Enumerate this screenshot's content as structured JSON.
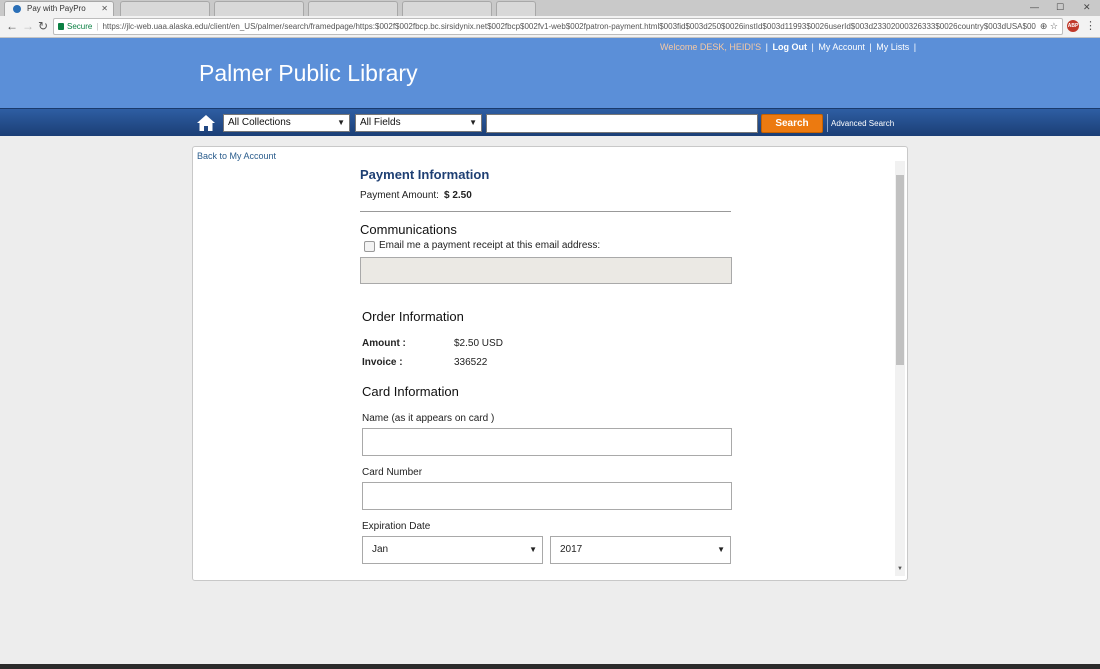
{
  "browser": {
    "active_tab_title": "Pay with PayPro",
    "url_secure_label": "Secure",
    "url": "https://jlc-web.uaa.alaska.edu/client/en_US/palmer/search/framedpage/https:$002f$002fbcp.bc.sirsidynix.net$002fbcp$002fv1-web$002fpatron-payment.html$003fid$003d250$0026instId$003d11993$0026userId$003d23302000326333$0026country$003dUSA$00",
    "ext_label": "ABP"
  },
  "header": {
    "brand": "Palmer Public Library",
    "welcome": "Welcome DESK, HEIDI'S",
    "logout": "Log Out",
    "my_account": "My Account",
    "my_lists": "My Lists",
    "pipe": "|"
  },
  "search": {
    "collection": "All Collections",
    "field": "All Fields",
    "button": "Search",
    "advanced": "Advanced Search"
  },
  "page": {
    "back_link": "Back to My Account",
    "payment_info_title": "Payment Information",
    "payment_amount_label": "Payment Amount:",
    "payment_amount_value": "$ 2.50",
    "communications_title": "Communications",
    "email_checkbox_label": "Email me a payment receipt at this email address:",
    "order_info_title": "Order Information",
    "amount_label": "Amount :",
    "amount_value": "$2.50 USD",
    "invoice_label": "Invoice :",
    "invoice_value": "336522",
    "card_info_title": "Card Information",
    "name_label": "Name (as it appears on card )",
    "card_number_label": "Card Number",
    "expiration_label": "Expiration Date",
    "exp_month": "Jan",
    "exp_year": "2017"
  },
  "colors": {
    "header_blue": "#5b8fd8",
    "search_bar": "#1b3e75",
    "search_button": "#ec7a10",
    "title_blue": "#1e3f73"
  }
}
